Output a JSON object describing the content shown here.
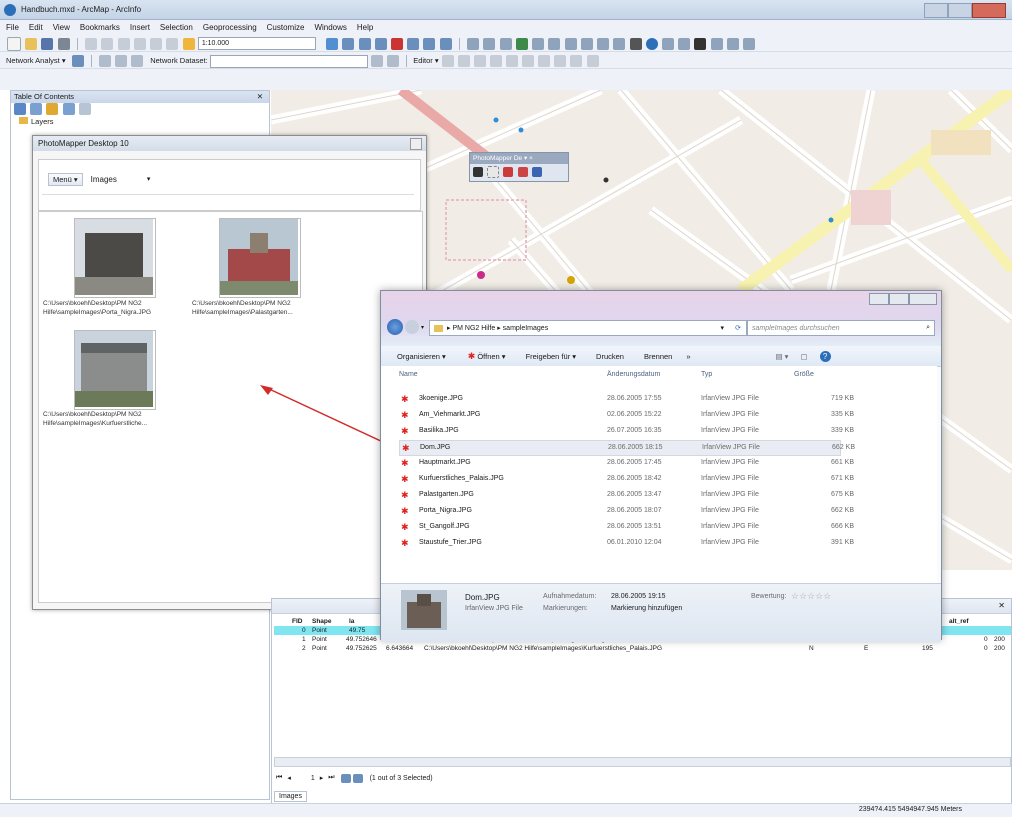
{
  "window": {
    "title": "Handbuch.mxd - ArcMap - ArcInfo"
  },
  "menu": [
    "File",
    "Edit",
    "View",
    "Bookmarks",
    "Insert",
    "Selection",
    "Geoprocessing",
    "Customize",
    "Windows",
    "Help"
  ],
  "toolbar": {
    "scale": "1:10.000",
    "network_analyst": "Network Analyst ▾",
    "network_dataset": "Network Dataset:",
    "editor": "Editor ▾"
  },
  "toc": {
    "title": "Table Of Contents",
    "layers_label": "Layers"
  },
  "photomapper": {
    "title": "PhotoMapper Desktop 10",
    "menu_button": "Menü ▾",
    "view_select": "Images",
    "thumbs": [
      {
        "caption": "C:\\Users\\bkoehl\\Desktop\\PM NG2 Hilfe\\sampleImages\\Porta_Nigra.JPG"
      },
      {
        "caption": "C:\\Users\\bkoehl\\Desktop\\PM NG2 Hilfe\\sampleImages\\Palastgarten..."
      },
      {
        "caption": "C:\\Users\\bkoehl\\Desktop\\PM NG2 Hilfe\\sampleImages\\Kurfuerstliche..."
      }
    ]
  },
  "floating_toolbar": {
    "title": "PhotoMapper De ▾ ×"
  },
  "explorer": {
    "breadcrumb": [
      "PM NG2 Hilfe",
      "sampleImages"
    ],
    "search_placeholder": "sampleImages durchsuchen",
    "commands": [
      "Organisieren ▾",
      "Öffnen ▾",
      "Freigeben für ▾",
      "Drucken",
      "Brennen",
      "»"
    ],
    "columns": [
      "Name",
      "Änderungsdatum",
      "Typ",
      "Größe"
    ],
    "files": [
      {
        "name": "3koenige.JPG",
        "date": "28.06.2005 17:55",
        "type": "IrfanView JPG File",
        "size": "719 KB"
      },
      {
        "name": "Am_Viehmarkt.JPG",
        "date": "02.06.2005 15:22",
        "type": "IrfanView JPG File",
        "size": "335 KB"
      },
      {
        "name": "Basilika.JPG",
        "date": "26.07.2005 16:35",
        "type": "IrfanView JPG File",
        "size": "339 KB"
      },
      {
        "name": "Dom.JPG",
        "date": "28.06.2005 18:15",
        "type": "IrfanView JPG File",
        "size": "662 KB"
      },
      {
        "name": "Hauptmarkt.JPG",
        "date": "28.06.2005 17:45",
        "type": "IrfanView JPG File",
        "size": "661 KB"
      },
      {
        "name": "Kurfuerstliches_Palais.JPG",
        "date": "28.06.2005 18:42",
        "type": "IrfanView JPG File",
        "size": "671 KB"
      },
      {
        "name": "Palastgarten.JPG",
        "date": "28.06.2005 13:47",
        "type": "IrfanView JPG File",
        "size": "675 KB"
      },
      {
        "name": "Porta_Nigra.JPG",
        "date": "28.06.2005 18:07",
        "type": "IrfanView JPG File",
        "size": "662 KB"
      },
      {
        "name": "St_Gangolf.JPG",
        "date": "28.06.2005 13:51",
        "type": "IrfanView JPG File",
        "size": "666 KB"
      },
      {
        "name": "Staustufe_Trier.JPG",
        "date": "06.01.2010 12:04",
        "type": "IrfanView JPG File",
        "size": "391 KB"
      }
    ],
    "details": {
      "filename": "Dom.JPG",
      "filetype": "IrfanView JPG File",
      "date_label": "Aufnahmedatum:",
      "date_value": "28.06.2005 19:15",
      "tags_label": "Markierungen:",
      "tags_value": "Markierung hinzufügen",
      "rating_label": "Bewertung:",
      "rating_stars": "☆☆☆☆☆"
    }
  },
  "attribute_table": {
    "headers": [
      "FID",
      "Shape",
      "la"
    ],
    "rows": [
      {
        "fid": "0",
        "shape": "Point",
        "lat": "49.75"
      },
      {
        "fid": "1",
        "shape": "Point",
        "lat": "49.752646",
        "lon": "6.643644",
        "path": "C:\\Users\\bkoehl\\Desktop\\PM NG2 Hilfe\\sampleImages\\Palastgarten.JPG",
        "n": "N",
        "e": "E",
        "v1": "218",
        "v2": "0",
        "v3": "200"
      },
      {
        "fid": "2",
        "shape": "Point",
        "lat": "49.752625",
        "lon": "6.643664",
        "path": "C:\\Users\\bkoehl\\Desktop\\PM NG2 Hilfe\\sampleImages\\Kurfuerstliches_Palais.JPG",
        "n": "N",
        "e": "E",
        "v1": "195",
        "v2": "0",
        "v3": "200"
      }
    ],
    "right_header": "alt_ref",
    "nav": "1",
    "selection_info": "(1 out of 3 Selected)",
    "tab": "Images"
  },
  "status": {
    "coords": "2394?4.415 5494947.945 Meters"
  }
}
